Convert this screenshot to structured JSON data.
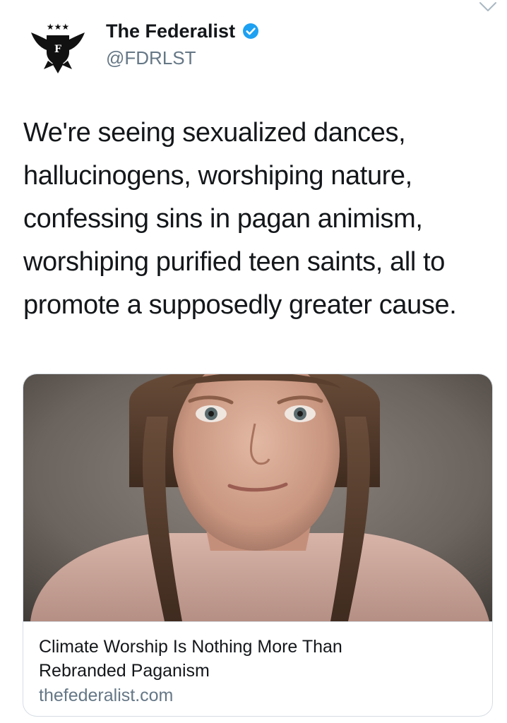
{
  "account": {
    "display_name": "The Federalist",
    "handle": "@FDRLST",
    "verified": true,
    "avatar_icon": "federalist-eagle-logo"
  },
  "tweet": {
    "text_lines": [
      "We're seeing sexualized dances,",
      "hallucinogens, worshiping nature,",
      "confessing sins in pagan animism,",
      "worshiping purified teen saints, all to",
      "promote a supposedly greater cause."
    ]
  },
  "card": {
    "image_icon": "article-photo",
    "title_lines": [
      "Climate Worship Is Nothing More Than",
      "Rebranded Paganism"
    ],
    "domain": "thefederalist.com"
  },
  "colors": {
    "text": "#14171a",
    "secondary": "#657786",
    "verified": "#1da1f2",
    "border": "#d6dde3"
  }
}
